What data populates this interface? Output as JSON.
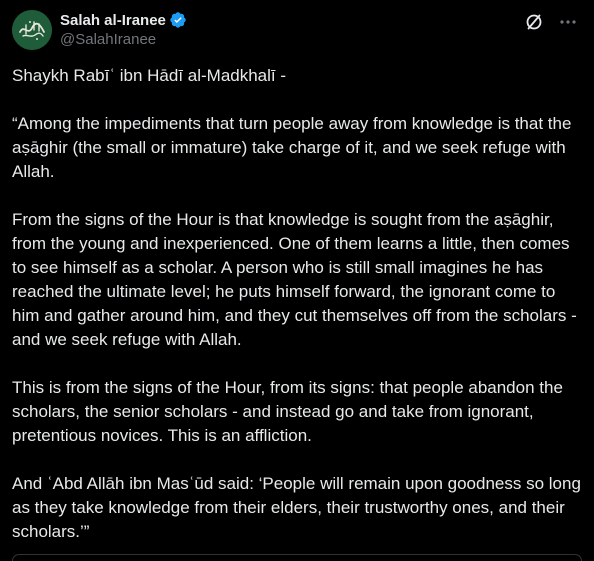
{
  "author": {
    "display_name": "Salah al-Iranee",
    "handle": "@SalahIranee",
    "avatar_icon": "calligraphy-avatar-icon",
    "verified_icon": "verified-badge-icon",
    "verified_color": "#1d9bf0",
    "avatar_color": "#1f5c3a"
  },
  "actions": {
    "grok_icon": "grok-slash-circle-icon",
    "more_icon": "more-dots-icon"
  },
  "post": {
    "paragraphs": [
      "Shaykh Rabīʿ ibn Hādī al-Madkhalī -",
      "“Among the impediments that turn people away from knowledge is that the aṣāghir (the small or immature) take charge of it, and we seek refuge with Allah.",
      "From the signs of the Hour is that knowledge is sought from the aṣāghir, from the young and inexperienced. One of them learns a little, then comes to see himself as a scholar. A person who is still small imagines he has reached the ultimate level; he puts himself forward, the ignorant come to him and gather around him, and they cut themselves off from the scholars - and we seek refuge with Allah.",
      "This is from the signs of the Hour, from its signs: that people abandon the scholars, the senior scholars - and instead go and take from ignorant, pretentious novices. This is an affliction.",
      "And ʿAbd Allāh ibn Masʿūd said: ‘People will remain upon goodness so long as they take knowledge from their elders, their trustworthy ones, and their scholars.’”"
    ]
  },
  "colors": {
    "background": "#000000",
    "text": "#e7e9ea",
    "muted": "#71767b"
  }
}
